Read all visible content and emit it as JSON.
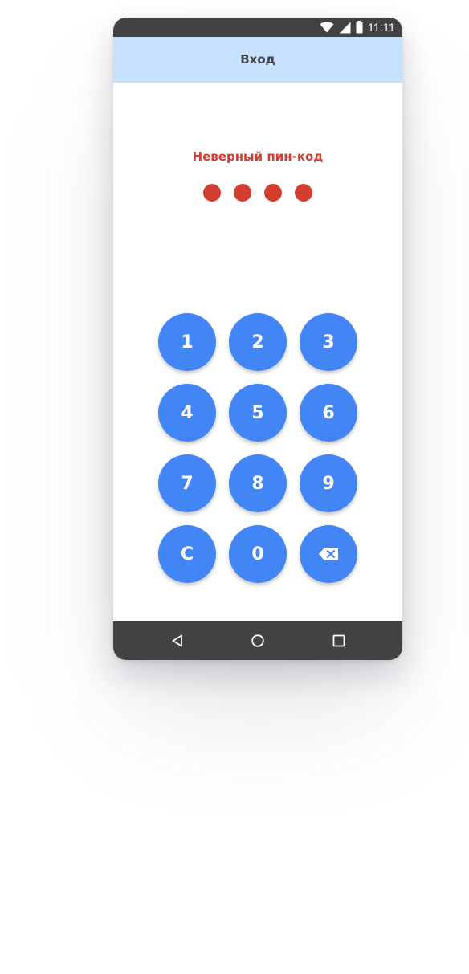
{
  "status_bar": {
    "time": "11:11",
    "icons": [
      "wifi-icon",
      "cellular-signal-icon",
      "battery-icon"
    ]
  },
  "app_bar": {
    "title": "Вход"
  },
  "pin": {
    "message": "Неверный пин-код",
    "entered_digits": 4,
    "max_digits": 4
  },
  "keypad": {
    "keys": [
      "1",
      "2",
      "3",
      "4",
      "5",
      "6",
      "7",
      "8",
      "9",
      "C",
      "0"
    ],
    "backspace_icon": "backspace-icon"
  },
  "nav_bar": {
    "icons": [
      "back-triangle-icon",
      "home-circle-icon",
      "recents-square-icon"
    ]
  },
  "colors": {
    "status_bar": "#424242",
    "app_bar": "#c5e1fd",
    "error": "#d23f31",
    "key": "#4285f4",
    "nav_bar": "#424242"
  }
}
